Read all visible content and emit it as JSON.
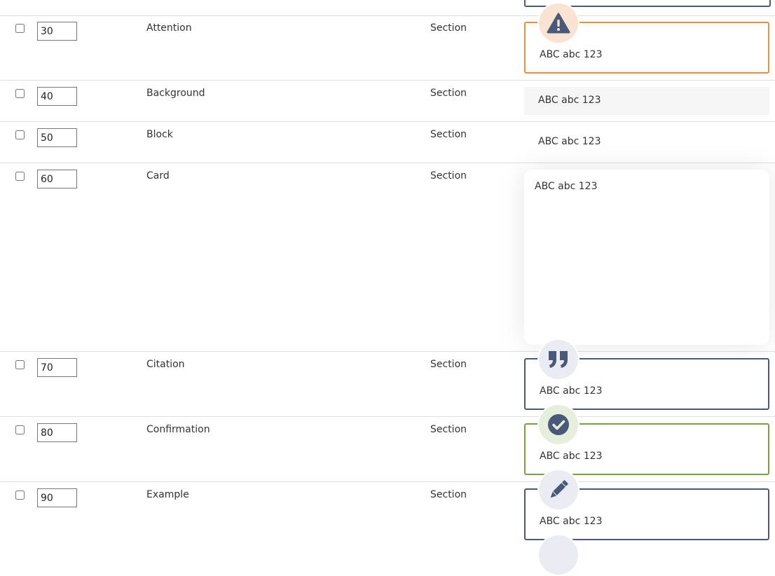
{
  "rows": [
    {
      "weight": "30",
      "name": "Attention",
      "type": "Section",
      "preview": "ABC abc 123"
    },
    {
      "weight": "40",
      "name": "Background",
      "type": "Section",
      "preview": "ABC abc 123"
    },
    {
      "weight": "50",
      "name": "Block",
      "type": "Section",
      "preview": "ABC abc 123"
    },
    {
      "weight": "60",
      "name": "Card",
      "type": "Section",
      "preview": "ABC abc 123"
    },
    {
      "weight": "70",
      "name": "Citation",
      "type": "Section",
      "preview": "ABC abc 123"
    },
    {
      "weight": "80",
      "name": "Confirmation",
      "type": "Section",
      "preview": "ABC abc 123"
    },
    {
      "weight": "90",
      "name": "Example",
      "type": "Section",
      "preview": "ABC abc 123"
    }
  ],
  "icons": {
    "attention": "warning-triangle-icon",
    "citation": "quote-icon",
    "confirmation": "check-circle-icon",
    "example": "pencil-icon"
  },
  "colors": {
    "border_default": "#48597a",
    "border_attention": "#e8913a",
    "border_confirmation": "#76a33a",
    "icon_fill": "#48597a",
    "row_divider": "#dddddd"
  }
}
